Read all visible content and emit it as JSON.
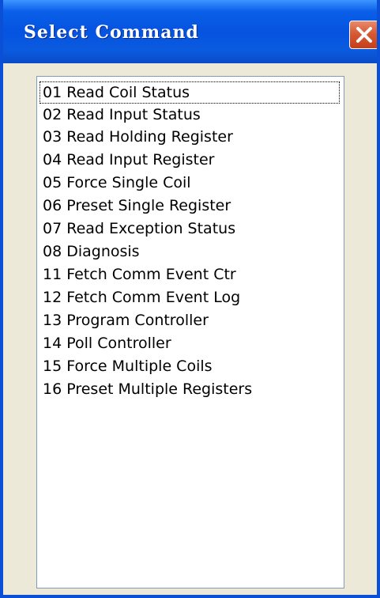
{
  "window": {
    "title": "Select Command",
    "close_label": "close"
  },
  "commands": {
    "items": [
      "01 Read Coil Status",
      "02 Read Input Status",
      "03 Read Holding Register",
      "04 Read Input Register",
      "05 Force Single Coil",
      "06 Preset Single Register",
      "07 Read Exception Status",
      "08 Diagnosis",
      "11 Fetch Comm Event Ctr",
      "12 Fetch Comm Event Log",
      "13 Program Controller",
      "14 Poll Controller",
      "15 Force Multiple Coils",
      "16 Preset Multiple Registers"
    ],
    "focused_index": 0
  },
  "colors": {
    "titlebar": "#0553e0",
    "close_button": "#d65a33",
    "dialog_background": "#ece9d8",
    "list_border": "#7f9db9"
  },
  "icons": {
    "close": "close-icon"
  }
}
